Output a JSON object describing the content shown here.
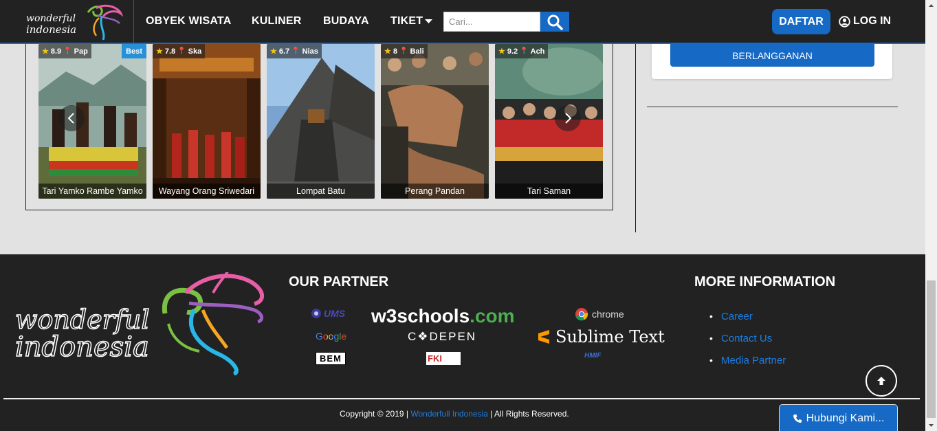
{
  "navbar": {
    "logo_line1": "wonderful",
    "logo_line2": "indonesia",
    "links": [
      "OBYEK WISATA",
      "KULINER",
      "BUDAYA",
      "TIKET"
    ],
    "search_placeholder": "Cari...",
    "daftar": "DAFTAR",
    "login": "LOG IN"
  },
  "carousel": {
    "cards": [
      {
        "rating": "8.9",
        "location": "Pap",
        "badge": "Best",
        "title": "Tari Yamko Rambe Yamko"
      },
      {
        "rating": "7.8",
        "location": "Ska",
        "title": "Wayang Orang Sriwedari"
      },
      {
        "rating": "6.7",
        "location": "Nias",
        "title": "Lompat Batu"
      },
      {
        "rating": "8",
        "location": "Bali",
        "title": "Perang Pandan"
      },
      {
        "rating": "9.2",
        "location": "Ach",
        "title": "Tari Saman"
      }
    ]
  },
  "sidebar": {
    "subscribe": "BERLANGGANAN"
  },
  "footer": {
    "logo_line1": "wonderful",
    "logo_line2": "indonesia",
    "partner_heading": "OUR PARTNER",
    "partners": {
      "ums": "UMS",
      "w3_a": "w3schools",
      "w3_b": ".com",
      "chrome": "chrome",
      "google": "Google",
      "codepen": "C❖DEPEN",
      "sublime": "Sublime Text",
      "bem": "BEM",
      "fki": "FKI",
      "hmif": "HMIF"
    },
    "info_heading": "MORE INFORMATION",
    "info_links": [
      "Career",
      "Contact Us",
      "Media Partner"
    ],
    "copyright_pre": "Copyright © 2019 |",
    "copyright_link": "Wonderfull Indonesia",
    "copyright_post": "| All Rights Reserved.",
    "contact": "Hubungi Kami..."
  },
  "colors": {
    "accent": "#1669c4",
    "link": "#1c7de0",
    "dark": "#222222"
  }
}
